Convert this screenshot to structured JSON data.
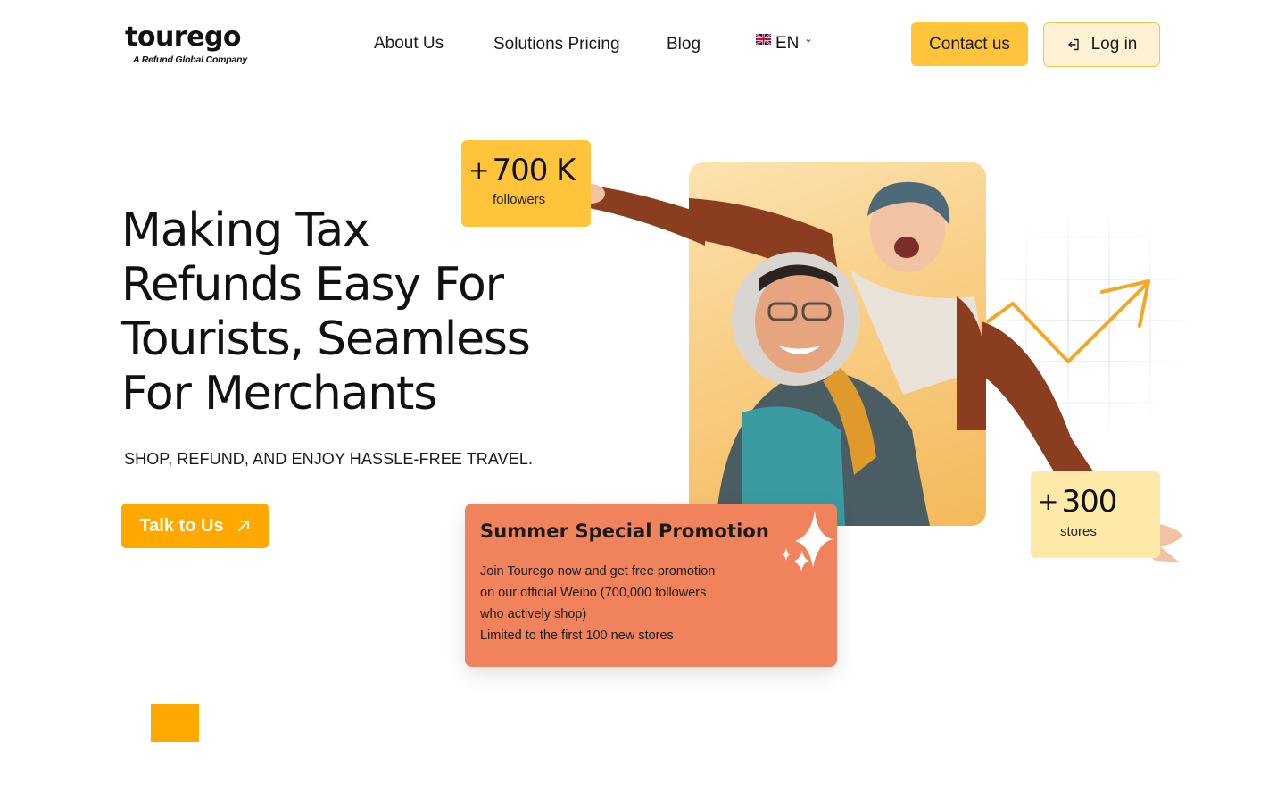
{
  "header": {
    "logo": {
      "word": "tourego",
      "tagline": "A Refund Global Company"
    },
    "nav": [
      "About Us",
      "Solutions Pricing",
      "Blog"
    ],
    "language": {
      "code": "EN",
      "flag_icon": "uk-flag-icon",
      "dropdown_icon": "chevron-down-icon"
    },
    "contact_label": "Contact us",
    "login_label": "Log in",
    "login_icon": "login-icon"
  },
  "hero": {
    "title_lines": [
      "Making Tax",
      "Refunds Easy For",
      "Tourists, Seamless",
      "For Merchants"
    ],
    "subtitle": "SHOP, REFUND, AND ENJOY HASSLE-FREE TRAVEL.",
    "cta_label": "Talk to Us",
    "cta_icon": "arrow-up-right-icon"
  },
  "stats": {
    "followers": {
      "value": "700 K",
      "label": "followers"
    },
    "stores": {
      "value": "300",
      "label": "stores"
    }
  },
  "promo": {
    "title": "Summer Special Promotion",
    "body_lines": [
      "Join Tourego now and get free promotion",
      "on our official Weibo (700,000 followers",
      "who actively shop)",
      "Limited to the first 100 new stores"
    ],
    "icon": "sparkle-icon"
  },
  "colors": {
    "accent": "#FFA800",
    "contact_bg": "#FFC43C",
    "login_bg": "#FFF1D4",
    "promo_bg": "#F0835B",
    "stores_card_bg": "#FFE9A9"
  }
}
